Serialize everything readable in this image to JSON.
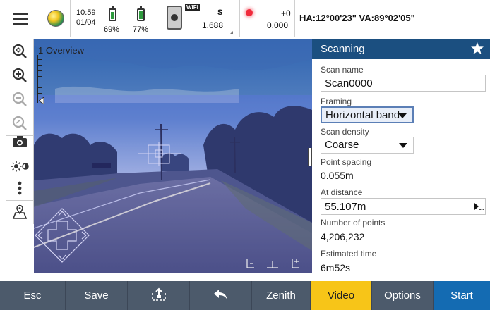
{
  "status_bar": {
    "menu_icon": "hamburger-menu-icon",
    "gps_icon": "globe-gps-icon",
    "time": "10:59",
    "date": "01/04",
    "battery1_percent": "69%",
    "battery1_level": 0.69,
    "battery2_percent": "77%",
    "battery2_level": 0.77,
    "instrument_icon": "scanner-instrument-icon",
    "wifi_label": "WiFi",
    "instrument_letter": "S",
    "instrument_value": "1.688",
    "laser_icon": "laser-pointer-icon",
    "offset_value": "+0",
    "offset_height": "0.000",
    "ha_va_text": "HA:12°00'23\"  VA:89°02'05\""
  },
  "toolbar": [
    {
      "name": "zoom-extents-icon"
    },
    {
      "name": "zoom-in-icon"
    },
    {
      "name": "zoom-out-icon"
    },
    {
      "name": "zoom-previous-icon"
    },
    {
      "name": "camera-icon"
    },
    {
      "name": "brightness-icon"
    },
    {
      "name": "more-options-icon"
    },
    {
      "name": "map-view-icon"
    }
  ],
  "camera": {
    "overview_label": "1 Overview",
    "scan_band_top_fraction": 0.24
  },
  "panel": {
    "title": "Scanning",
    "star_icon": "star-favorite-icon",
    "scan_name_label": "Scan name",
    "scan_name_value": "Scan0000",
    "framing_label": "Framing",
    "framing_value": "Horizontal band",
    "density_label": "Scan density",
    "density_value": "Coarse",
    "point_spacing_label": "Point spacing",
    "point_spacing_value": "0.055m",
    "at_distance_label": "At distance",
    "at_distance_value": "55.107m",
    "num_points_label": "Number of points",
    "num_points_value": "4,206,232",
    "est_time_label": "Estimated time",
    "est_time_value": "6m52s"
  },
  "bottom_bar": {
    "esc": "Esc",
    "save": "Save",
    "transfer_icon": "transfer-upload-icon",
    "back_icon": "back-arrow-icon",
    "zenith": "Zenith",
    "video": "Video",
    "options": "Options",
    "start": "Start"
  },
  "colors": {
    "header_blue": "#1b4f80",
    "video_yellow": "#f7c518",
    "start_blue": "#146bb2",
    "bottom_gray": "#4c5a6b"
  }
}
